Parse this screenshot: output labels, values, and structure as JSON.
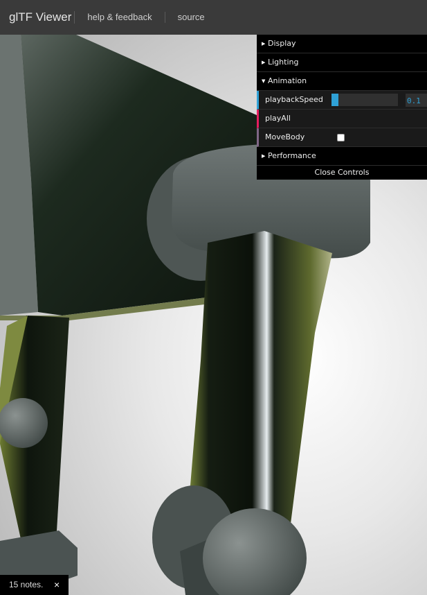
{
  "header": {
    "app_title": "glTF Viewer",
    "links": [
      "help & feedback",
      "source"
    ]
  },
  "gui": {
    "folders": {
      "display": "Display",
      "lighting": "Lighting",
      "animation": "Animation",
      "performance": "Performance"
    },
    "controls": {
      "playback_speed_label": "playbackSpeed",
      "playback_speed_value": "0.1",
      "playback_speed_fraction": 0.1,
      "play_all_label": "playAll",
      "move_body_label": "MoveBody",
      "move_body_checked": false
    },
    "close_label": "Close Controls"
  },
  "notes": {
    "text": "15 notes.",
    "close": "×"
  },
  "colors": {
    "header_bg": "#3a3a3a",
    "number_accent": "#2fa1d6",
    "function_accent": "#e61d5f",
    "boolean_accent": "#806787"
  }
}
